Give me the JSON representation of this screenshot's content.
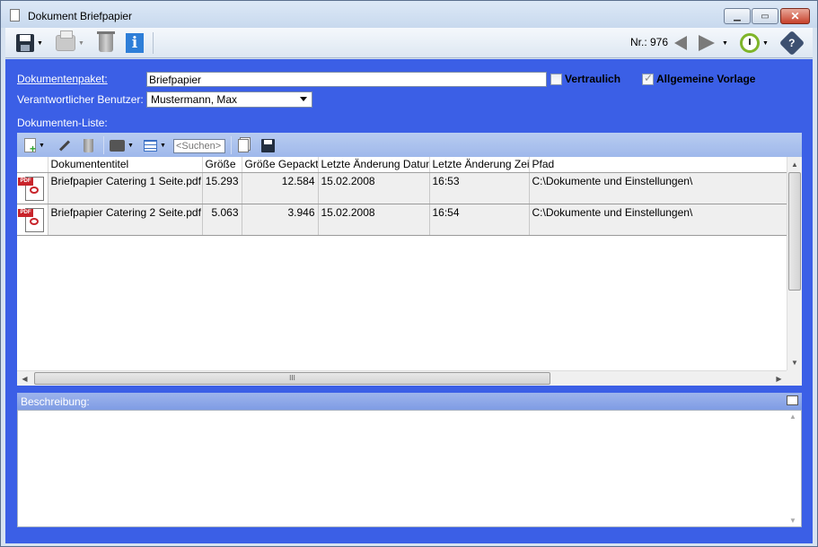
{
  "window": {
    "title": "Dokument Briefpapier",
    "icons": {
      "document": "document-icon",
      "minimize": "minimize-icon",
      "maximize": "maximize-icon",
      "close": "close-icon"
    }
  },
  "toolbar": {
    "icons": [
      "save-icon",
      "print-icon",
      "trash-icon",
      "info-icon",
      "arrow-left-icon",
      "arrow-right-icon",
      "timer-icon",
      "help-icon"
    ],
    "nr_label": "Nr.: 976"
  },
  "form": {
    "dokumentenpaket_label": "Dokumentenpaket:",
    "dokumentenpaket_value": "Briefpapier",
    "vertraulich_label": "Vertraulich",
    "vertraulich_checked": false,
    "allgemeine_vorlage_label": "Allgemeine Vorlage",
    "allgemeine_vorlage_checked": true,
    "verantwortlicher_label": "Verantwortlicher Benutzer:",
    "verantwortlicher_value": "Mustermann, Max",
    "dokumenten_liste_label": "Dokumenten-Liste:"
  },
  "list_toolbar": {
    "search_placeholder": "<Suchen>",
    "icons": [
      "new-document-icon",
      "edit-icon",
      "delete-icon",
      "print-icon",
      "view-grid-icon",
      "copy-icon",
      "save-icon"
    ]
  },
  "table": {
    "columns": [
      "",
      "Dokumententitel",
      "Größe",
      "Größe Gepackt",
      "Letzte Änderung Datum",
      "Letzte Änderung Zeit",
      "Pfad"
    ],
    "rows": [
      {
        "titel": "Briefpapier Catering 1 Seite.pdf",
        "groesse": "15.293",
        "gepackt": "12.584",
        "datum": "15.02.2008",
        "zeit": "16:53",
        "pfad": "C:\\Dokumente und Einstellungen\\"
      },
      {
        "titel": "Briefpapier Catering 2 Seite.pdf",
        "groesse": "5.063",
        "gepackt": "3.946",
        "datum": "15.02.2008",
        "zeit": "16:54",
        "pfad": "C:\\Dokumente und Einstellungen\\"
      }
    ],
    "pdf_badge": "PDF",
    "scroll_grip": "III"
  },
  "beschreibung": {
    "label": "Beschreibung:",
    "value": ""
  }
}
